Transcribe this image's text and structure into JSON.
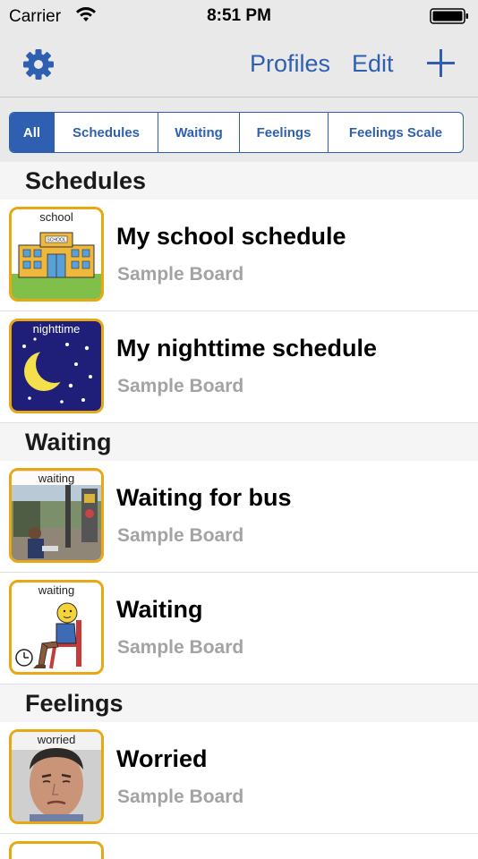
{
  "status_bar": {
    "carrier": "Carrier",
    "time": "8:51 PM"
  },
  "nav": {
    "profiles": "Profiles",
    "edit": "Edit"
  },
  "filters": [
    "All",
    "Schedules",
    "Waiting",
    "Feelings",
    "Feelings Scale"
  ],
  "sections": {
    "schedules": "Schedules",
    "waiting": "Waiting",
    "feelings": "Feelings"
  },
  "rows": [
    {
      "thumb_label": "school",
      "title": "My school schedule",
      "subtitle": "Sample Board"
    },
    {
      "thumb_label": "nighttime",
      "title": "My nighttime schedule",
      "subtitle": "Sample Board"
    },
    {
      "thumb_label": "waiting",
      "title": "Waiting for bus",
      "subtitle": "Sample Board"
    },
    {
      "thumb_label": "waiting",
      "title": "Waiting",
      "subtitle": "Sample Board"
    },
    {
      "thumb_label": "worried",
      "title": "Worried",
      "subtitle": "Sample Board"
    }
  ],
  "school_sign": "SCHOOL",
  "colors": {
    "accent": "#2e5fb1",
    "thumb_border": "#e8a713",
    "subtitle": "#a3a3a3"
  }
}
